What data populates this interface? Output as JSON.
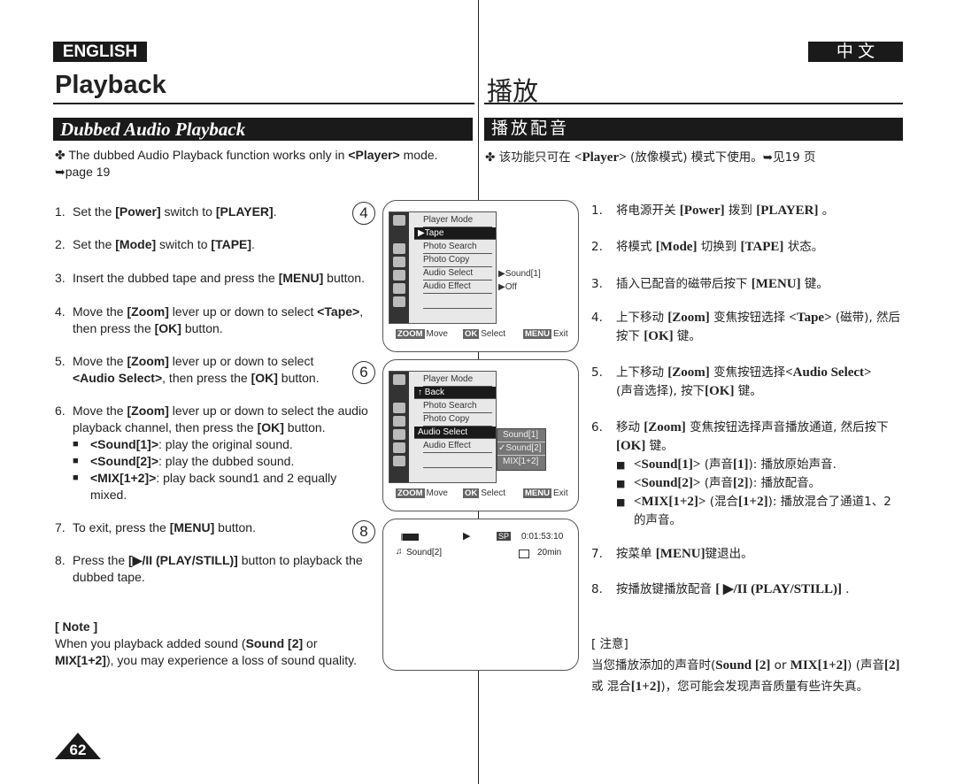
{
  "header": {
    "lang_en": "ENGLISH",
    "lang_zh": "中 文",
    "title_en": "Playback",
    "title_zh": "播放"
  },
  "section": {
    "title_en": "Dubbed Audio Playback",
    "title_zh": "播放配音"
  },
  "intro": {
    "en": "✤ The dubbed Audio Playback function works only in **<Player>** mode. ➥page 19",
    "zh": "✤  该功能只可在 **<Player>** (放像模式) 模式下使用。➥见19 页"
  },
  "steps_en": [
    {
      "n": "1.",
      "text": "Set the **[Power]** switch to **[PLAYER]**."
    },
    {
      "n": "2.",
      "text": "Set the **[Mode]** switch to **[TAPE]**."
    },
    {
      "n": "3.",
      "text": "Insert the dubbed tape and press the **[MENU]** button."
    },
    {
      "n": "4.",
      "text": "Move the **[Zoom]** lever up or down to select **<Tape>**, then press the **[OK]** button."
    },
    {
      "n": "5.",
      "text": "Move the **[Zoom]** lever up or down to select **<Audio Select>**, then press the **[OK]** button."
    },
    {
      "n": "6.",
      "text": "Move the **[Zoom]** lever up or down to select the audio playback channel, then press the **[OK]** button."
    },
    {
      "n": "7.",
      "text": "To exit, press the **[MENU]** button."
    },
    {
      "n": "8.",
      "text": "Press the **[▶/II (PLAY/STILL)]** button to playback the dubbed tape."
    }
  ],
  "bullets_en": [
    "**<Sound[1]>**: play the original sound.",
    "**<Sound[2]>**: play the dubbed sound.",
    "**<MIX[1+2]>**: play back sound1 and 2 equally mixed."
  ],
  "note_en": {
    "title": "[ Note ]",
    "text": "When you playback added sound (**Sound [2]** or **MIX[1+2]**), you may experience a loss of sound quality."
  },
  "steps_zh": [
    {
      "n": "1.",
      "text": "将电源开关 **[Power]** 拨到 **[PLAYER]** 。"
    },
    {
      "n": "2.",
      "text": "将模式 **[Mode]** 切换到 **[TAPE]** 状态。"
    },
    {
      "n": "3.",
      "text": "插入已配音的磁带后按下 **[MENU]** 键。"
    },
    {
      "n": "4.",
      "text": "上下移动 **[Zoom]** 变焦按钮选择 **<Tape>** (磁带), 然后按下 **[OK]** 键。"
    },
    {
      "n": "5.",
      "text": "上下移动 **[Zoom]** 变焦按钮选择**<Audio Select>** (声音选择), 按下**[OK]** 键。"
    },
    {
      "n": "6.",
      "text": "移动 **[Zoom]** 变焦按钮选择声音播放通道, 然后按下**[OK]** 键。"
    },
    {
      "n": "7.",
      "text": "按菜单 **[MENU]**键退出。"
    },
    {
      "n": "8.",
      "text": "按播放键播放配音 **[ ▶/II (PLAY/STILL)]** ."
    }
  ],
  "bullets_zh": [
    "**<Sound[1]>** (声音**[1]**): 播放原始声音.",
    "**<Sound[2]>** (声音**[2]**): 播放配音。",
    "**<MIX[1+2]>** (混合**[1+2]**): 播放混合了通道1、2的声音。"
  ],
  "note_zh": {
    "title": "[ 注意]",
    "text": "当您播放添加的声音时(**Sound [2]** or **MIX[1+2]**) (声音**[2]** 或 混合**[1+2]**)，您可能会发现声音质量有些许失真。"
  },
  "step_markers": [
    "4",
    "6",
    "8"
  ],
  "screen1": {
    "items": [
      "Player Mode",
      "▶Tape",
      "Photo Search",
      "Photo Copy",
      "Audio Select",
      "Audio Effect"
    ],
    "values": [
      "▶Sound[1]",
      "▶Off"
    ]
  },
  "screen2": {
    "items": [
      "Player Mode",
      "↑ Back",
      "Photo Search",
      "Photo Copy",
      "Audio Select",
      "Audio Effect"
    ],
    "options": [
      "Sound[1]",
      "✓Sound[2]",
      "MIX[1+2]"
    ]
  },
  "footer_keys": {
    "zoom": "ZOOM",
    "move": "Move",
    "ok": "OK",
    "select": "Select",
    "menu": "MENU",
    "exit": "Exit"
  },
  "screen3": {
    "mode": "SP",
    "timecode": "0:01:53:10",
    "sound": "Sound[2]",
    "remaining": "20min",
    "play_icon": "▶"
  },
  "page_number": "62"
}
